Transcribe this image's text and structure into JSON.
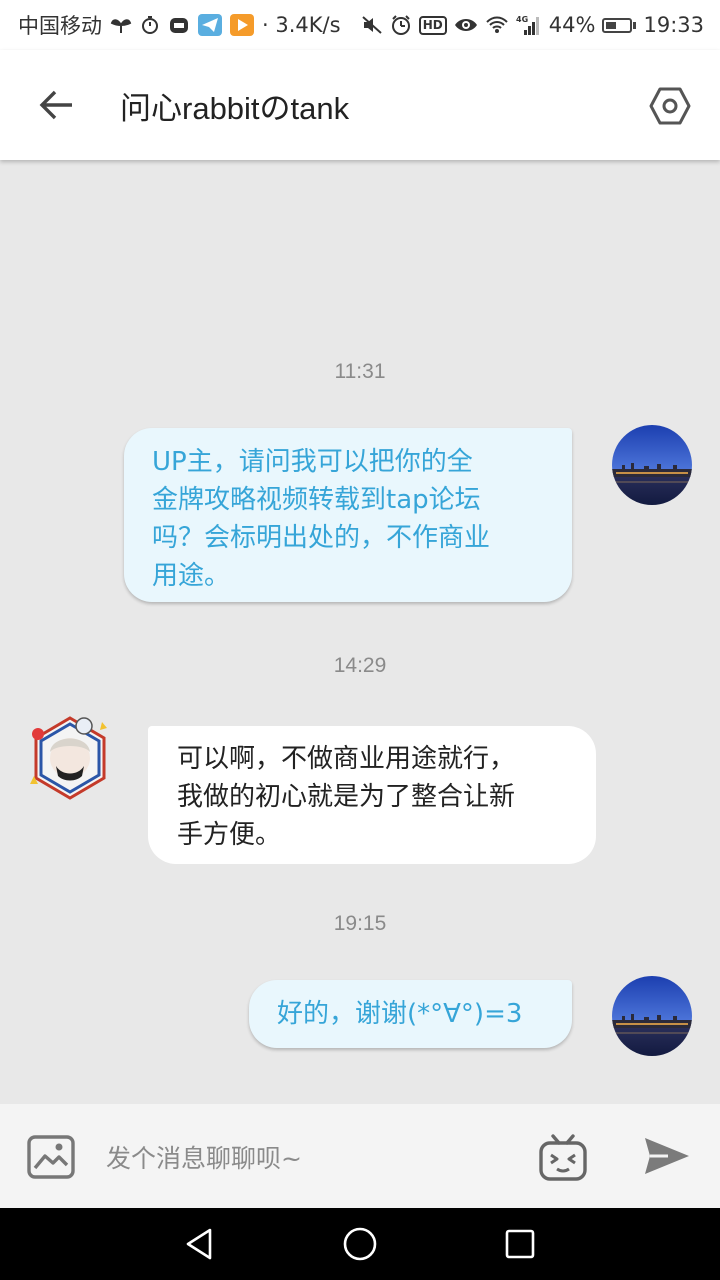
{
  "status_bar": {
    "carrier": "中国移动",
    "speed": "3.4K/s",
    "network": "4G",
    "battery": "44%",
    "time": "19:33"
  },
  "header": {
    "title": "问心rabbitのtank"
  },
  "messages": [
    {
      "timestamp": "11:31",
      "sender": "me",
      "text": [
        "UP主，请问我可以把你的全",
        "金牌攻略视频转载到tap论坛",
        "吗？会标明出处的，不作商业",
        "用途。"
      ]
    },
    {
      "timestamp": "14:29",
      "sender": "them",
      "text": [
        "可以啊，不做商业用途就行，",
        "我做的初心就是为了整合让新",
        "手方便。"
      ]
    },
    {
      "timestamp": "19:15",
      "sender": "me",
      "text": [
        "好的，谢谢(*°∀°)=3"
      ]
    }
  ],
  "input": {
    "placeholder": "发个消息聊聊呗~"
  },
  "colors": {
    "me_bubble_bg": "#e9f7fd",
    "me_text": "#36a5d8",
    "them_bubble_bg": "#ffffff",
    "chat_bg": "#e8e8e8"
  },
  "icons": {
    "back": "arrow-left-icon",
    "settings": "hexagon-settings-icon",
    "image": "image-icon",
    "emoji": "bilibili-tv-emoji-icon",
    "send": "send-icon"
  }
}
